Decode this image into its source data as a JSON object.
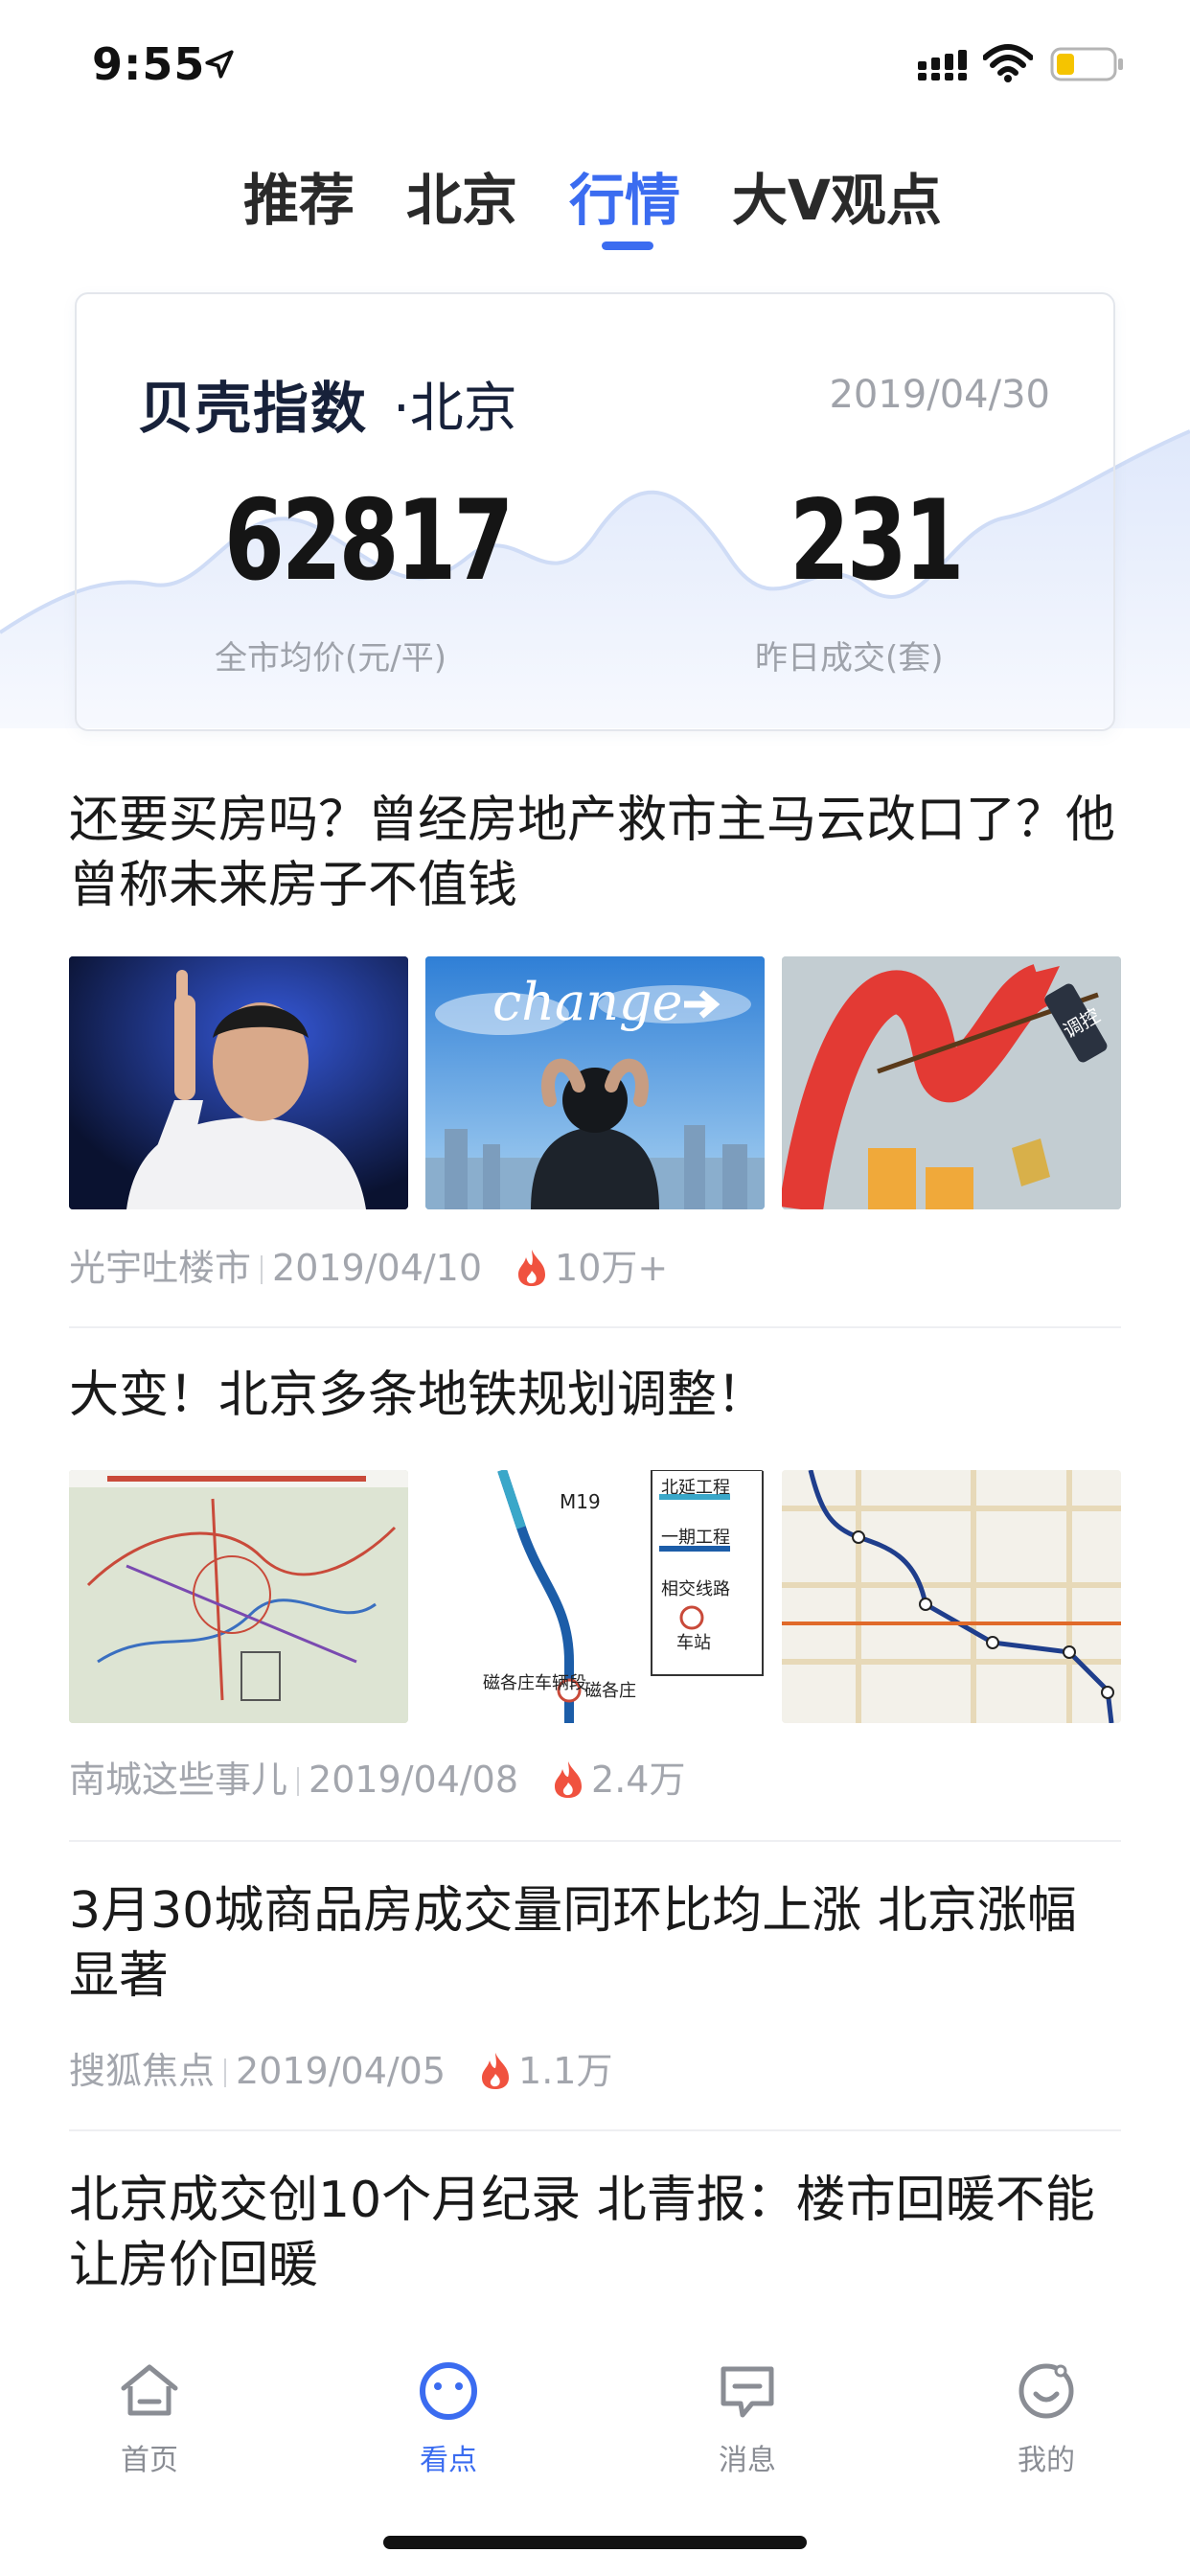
{
  "status_bar": {
    "time": "9:55"
  },
  "tabs": [
    {
      "label": "推荐",
      "active": false
    },
    {
      "label": "北京",
      "active": false
    },
    {
      "label": "行情",
      "active": true
    },
    {
      "label": "大V观点",
      "active": false
    }
  ],
  "index_card": {
    "brand": "贝壳指数",
    "city": "·北京",
    "date": "2019/04/30",
    "avg_price": {
      "value": "62817",
      "label": "全市均价(元/平)"
    },
    "deals": {
      "value": "231",
      "label": "昨日成交(套)"
    }
  },
  "articles": [
    {
      "title": "还要买房吗？曾经房地产救市主马云改口了？他曾称未来房子不值钱",
      "source": "光宇吐楼市",
      "date": "2019/04/10",
      "hot": "10万+",
      "thumbs": [
        "man-pointing-photo",
        "change-sky-photo",
        "rising-arrow-cartoon"
      ],
      "thumb_text": {
        "change": "change",
        "cartoon": "调控"
      }
    },
    {
      "title": "大变！北京多条地铁规划调整！",
      "source": "南城这些事儿",
      "date": "2019/04/08",
      "hot": "2.4万",
      "thumbs": [
        "metro-plan-map",
        "metro-line-legend",
        "metro-station-map"
      ],
      "thumb_text": {
        "m19": "M19",
        "legend1": "北延工程",
        "legend2": "一期工程",
        "legend3": "相交线路",
        "legend4": "车站",
        "depot": "磁各庄车辆段",
        "station": "磁各庄"
      }
    },
    {
      "title": "3月30城商品房成交量同环比均上涨 北京涨幅显著",
      "source": "搜狐焦点",
      "date": "2019/04/05",
      "hot": "1.1万"
    },
    {
      "title": "北京成交创10个月纪录 北青报：楼市回暖不能让房价回暖"
    }
  ],
  "tabbar": [
    {
      "label": "首页",
      "icon": "house-icon",
      "active": false
    },
    {
      "label": "看点",
      "icon": "smile-circle-icon",
      "active": true
    },
    {
      "label": "消息",
      "icon": "message-icon",
      "active": false
    },
    {
      "label": "我的",
      "icon": "profile-smile-icon",
      "active": false
    }
  ],
  "colors": {
    "accent": "#3b6cf0",
    "hot": "#f0523f",
    "text_muted": "#a3a6ad"
  }
}
